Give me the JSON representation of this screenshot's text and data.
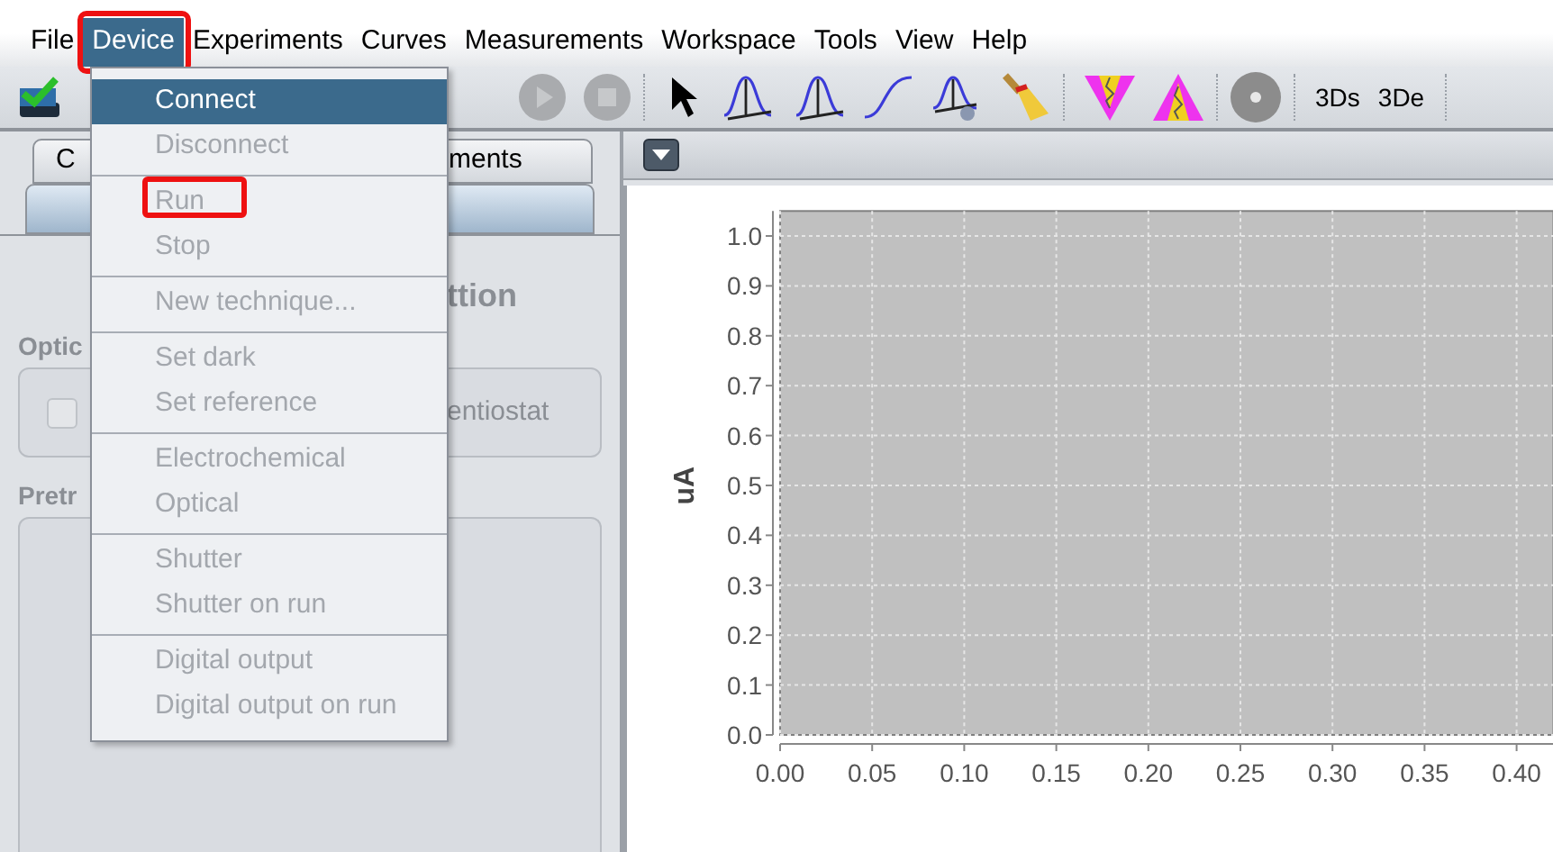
{
  "menu_bar": [
    {
      "label": "File",
      "selected": false,
      "annotated": false
    },
    {
      "label": "Device",
      "selected": true,
      "annotated": true
    },
    {
      "label": "Experiments",
      "selected": false,
      "annotated": false
    },
    {
      "label": "Curves",
      "selected": false,
      "annotated": false
    },
    {
      "label": "Measurements",
      "selected": false,
      "annotated": false
    },
    {
      "label": "Workspace",
      "selected": false,
      "annotated": false
    },
    {
      "label": "Tools",
      "selected": false,
      "annotated": false
    },
    {
      "label": "View",
      "selected": false,
      "annotated": false
    },
    {
      "label": "Help",
      "selected": false,
      "annotated": false
    }
  ],
  "device_menu": {
    "groups": [
      {
        "items": [
          {
            "label": "Connect",
            "highlighted": true,
            "disabled": false,
            "annotated": false
          },
          {
            "label": "Disconnect",
            "highlighted": false,
            "disabled": true,
            "annotated": false
          }
        ]
      },
      {
        "items": [
          {
            "label": "Run",
            "highlighted": false,
            "disabled": true,
            "annotated": true
          },
          {
            "label": "Stop",
            "highlighted": false,
            "disabled": true,
            "annotated": false
          }
        ]
      },
      {
        "items": [
          {
            "label": "New technique...",
            "highlighted": false,
            "disabled": true,
            "annotated": false
          }
        ]
      },
      {
        "items": [
          {
            "label": "Set dark",
            "highlighted": false,
            "disabled": true,
            "annotated": false
          },
          {
            "label": "Set reference",
            "highlighted": false,
            "disabled": true,
            "annotated": false
          }
        ]
      },
      {
        "items": [
          {
            "label": "Electrochemical",
            "highlighted": false,
            "disabled": true,
            "annotated": false
          },
          {
            "label": "Optical",
            "highlighted": false,
            "disabled": true,
            "annotated": false
          }
        ]
      },
      {
        "items": [
          {
            "label": "Shutter",
            "highlighted": false,
            "disabled": true,
            "annotated": false
          },
          {
            "label": "Shutter on run",
            "highlighted": false,
            "disabled": true,
            "annotated": false
          }
        ]
      },
      {
        "items": [
          {
            "label": "Digital output",
            "highlighted": false,
            "disabled": true,
            "annotated": false
          },
          {
            "label": "Digital output on run",
            "highlighted": false,
            "disabled": true,
            "annotated": false
          }
        ]
      }
    ]
  },
  "toolbar": {
    "text_buttons": [
      "3Ds",
      "3De"
    ]
  },
  "left_panel": {
    "tabs": [
      {
        "label": "C",
        "selected": false
      },
      {
        "label": "ments",
        "selected": false
      },
      {
        "selected": true
      }
    ],
    "heading": "ttion",
    "groups": [
      {
        "title": "Optic",
        "checkbox": {
          "label": "entiostat",
          "checked": false
        }
      },
      {
        "title": "Pretr"
      }
    ]
  },
  "right_panel": {
    "chart_data": {
      "type": "line",
      "grid": true,
      "ylabel": "uA",
      "xlim": [
        0,
        0.42
      ],
      "ylim": [
        0,
        1.05
      ],
      "xticks": [
        {
          "value": 0,
          "label": "0.00"
        },
        {
          "value": 0.05,
          "label": "0.05"
        },
        {
          "value": 0.1,
          "label": "0.10"
        },
        {
          "value": 0.15,
          "label": "0.15"
        },
        {
          "value": 0.2,
          "label": "0.20"
        },
        {
          "value": 0.25,
          "label": "0.25"
        },
        {
          "value": 0.3,
          "label": "0.30"
        },
        {
          "value": 0.35,
          "label": "0.35"
        },
        {
          "value": 0.4,
          "label": "0.40"
        }
      ],
      "yticks": [
        {
          "value": 0,
          "label": "0.0"
        },
        {
          "value": 0.1,
          "label": "0.1"
        },
        {
          "value": 0.2,
          "label": "0.2"
        },
        {
          "value": 0.3,
          "label": "0.3"
        },
        {
          "value": 0.4,
          "label": "0.4"
        },
        {
          "value": 0.5,
          "label": "0.5"
        },
        {
          "value": 0.6,
          "label": "0.6"
        },
        {
          "value": 0.7,
          "label": "0.7"
        },
        {
          "value": 0.8,
          "label": "0.8"
        },
        {
          "value": 0.9,
          "label": "0.9"
        },
        {
          "value": 1,
          "label": "1.0"
        }
      ]
    }
  }
}
